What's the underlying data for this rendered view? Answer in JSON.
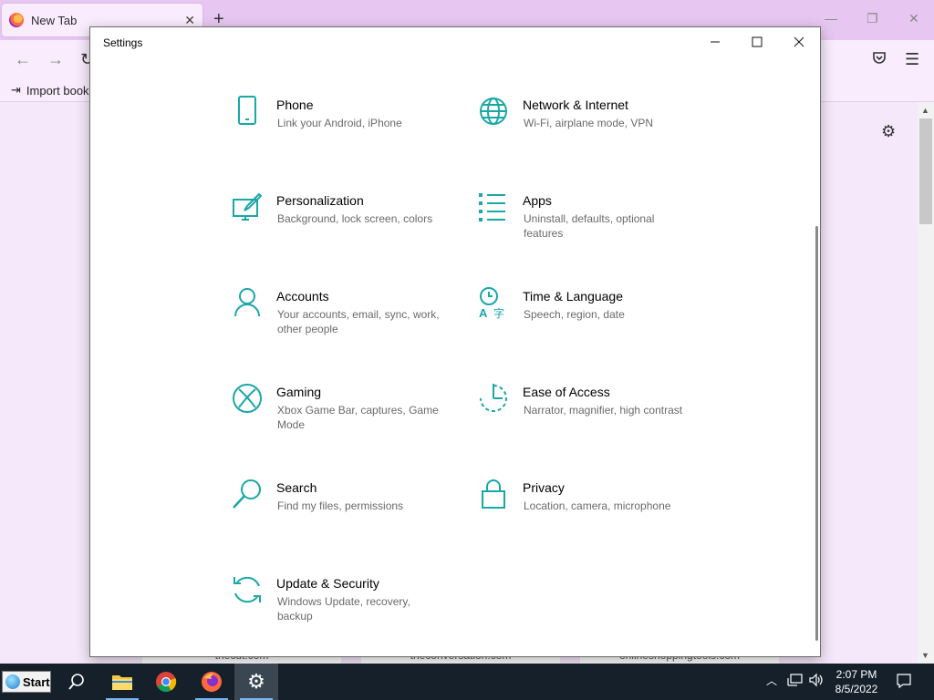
{
  "browser": {
    "tab_title": "New Tab",
    "tab_close": "✕",
    "new_tab": "+",
    "bookmark_import": "Import book",
    "tiles": [
      "thecut.com",
      "theconversation.com",
      "onlineshoppingtools.com"
    ]
  },
  "settings": {
    "title": "Settings",
    "items": [
      {
        "label": "Phone",
        "desc": "Link your Android, iPhone",
        "icon": "phone-icon"
      },
      {
        "label": "Network & Internet",
        "desc": "Wi-Fi, airplane mode, VPN",
        "icon": "globe-icon"
      },
      {
        "label": "Personalization",
        "desc": "Background, lock screen, colors",
        "icon": "paintbrush-icon"
      },
      {
        "label": "Apps",
        "desc": "Uninstall, defaults, optional features",
        "icon": "apps-list-icon"
      },
      {
        "label": "Accounts",
        "desc": "Your accounts, email, sync, work, other people",
        "icon": "person-icon"
      },
      {
        "label": "Time & Language",
        "desc": "Speech, region, date",
        "icon": "time-language-icon"
      },
      {
        "label": "Gaming",
        "desc": "Xbox Game Bar, captures, Game Mode",
        "icon": "xbox-icon"
      },
      {
        "label": "Ease of Access",
        "desc": "Narrator, magnifier, high contrast",
        "icon": "ease-of-access-icon"
      },
      {
        "label": "Search",
        "desc": "Find my files, permissions",
        "icon": "search-icon"
      },
      {
        "label": "Privacy",
        "desc": "Location, camera, microphone",
        "icon": "lock-icon"
      },
      {
        "label": "Update & Security",
        "desc": "Windows Update, recovery, backup",
        "icon": "sync-icon"
      }
    ]
  },
  "taskbar": {
    "start_label": "Start",
    "time": "2:07 PM",
    "date": "8/5/2022"
  },
  "colors": {
    "accent": "#1aa7a7",
    "taskbar": "#15202b",
    "browser_tabbar": "#e7c7f1"
  }
}
